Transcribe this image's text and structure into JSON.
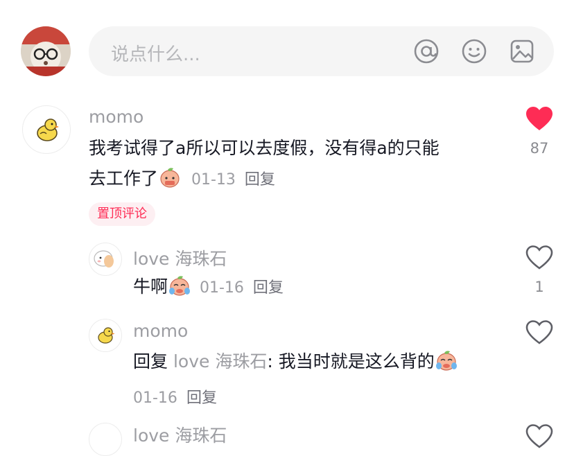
{
  "input": {
    "placeholder": "说点什么..."
  },
  "pinned_label": "置顶评论",
  "comments": [
    {
      "user": "momo",
      "text_line1": "我考试得了a所以可以去度假，没有得a的只能",
      "text_line2": "去工作了",
      "date": "01-13",
      "reply_label": "回复",
      "likes": "87",
      "liked": true
    },
    {
      "user": "love 海珠石",
      "text": "牛啊",
      "date": "01-16",
      "reply_label": "回复",
      "likes": "1",
      "liked": false
    },
    {
      "user": "momo",
      "reply_prefix": "回复",
      "mention": "love 海珠石",
      "text": ": 我当时就是这么背的",
      "date": "01-16",
      "reply_label": "回复",
      "liked": false
    },
    {
      "user": "love 海珠石"
    }
  ],
  "colors": {
    "accent": "#fe2c55",
    "muted": "#9c9da2",
    "input_bg": "#f5f5f5"
  },
  "icons": [
    "at-icon",
    "emoji-icon",
    "image-icon",
    "heart-filled-icon",
    "heart-outline-icon",
    "chick-icon",
    "cry-emoji-icon"
  ]
}
